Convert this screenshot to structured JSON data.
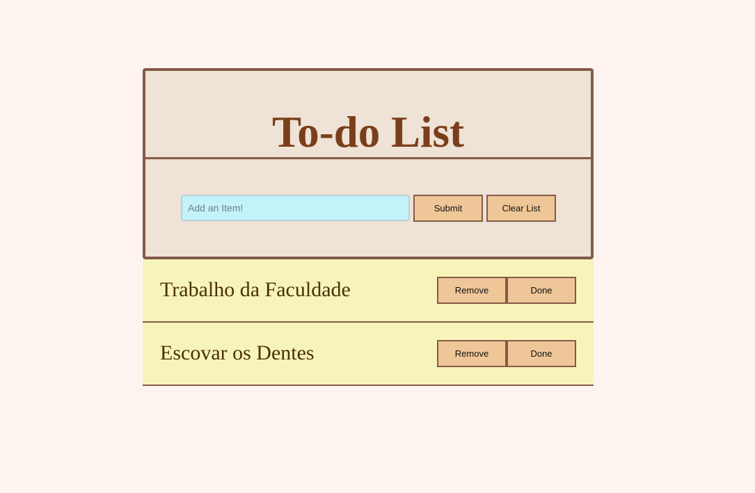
{
  "header": {
    "title": "To-do List"
  },
  "form": {
    "input_placeholder": "Add an Item!",
    "input_value": "",
    "submit_label": "Submit",
    "clear_label": "Clear List"
  },
  "items": [
    {
      "text": "Trabalho da Faculdade",
      "remove_label": "Remove",
      "done_label": "Done"
    },
    {
      "text": "Escovar os Dentes",
      "remove_label": "Remove",
      "done_label": "Done"
    }
  ],
  "colors": {
    "page_background": "#fdf4ef",
    "card_background": "#efe2d6",
    "border": "#845a48",
    "title": "#7a3f1a",
    "input_background": "#c2f3fb",
    "button_background": "#efc698",
    "item_background": "#f6f4b8",
    "item_text": "#4a2f08"
  }
}
